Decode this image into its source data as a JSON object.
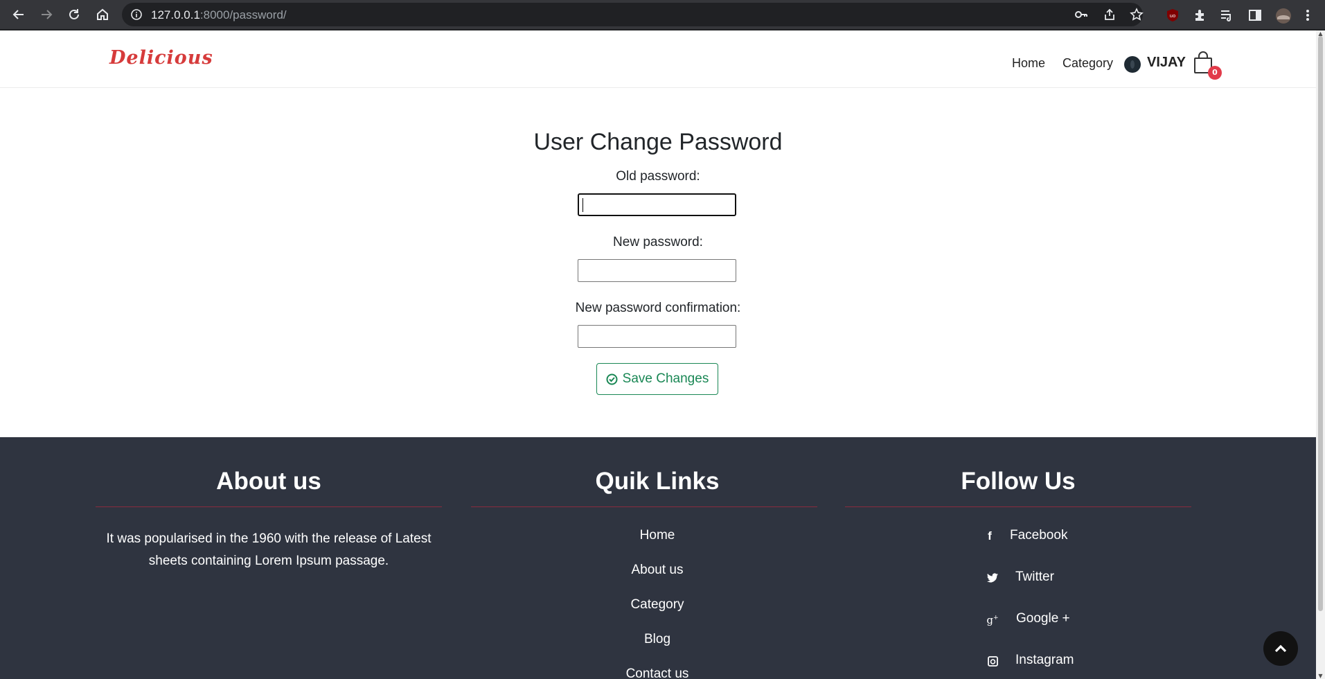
{
  "browser": {
    "url_host": "127.0.0.1",
    "url_rest": ":8000/password/"
  },
  "site": {
    "logo": "Delicious",
    "nav": {
      "home": "Home",
      "category": "Category"
    },
    "user_name": "VIJAY",
    "cart_count": "0"
  },
  "form": {
    "title": "User Change Password",
    "old_password_label": "Old password:",
    "new_password_label": "New password:",
    "confirm_label": "New password confirmation:",
    "save_label": "Save Changes"
  },
  "footer": {
    "about": {
      "heading": "About us",
      "text": "It was popularised in the 1960 with the release of Latest sheets containing Lorem Ipsum passage."
    },
    "links": {
      "heading": "Quik Links",
      "items": [
        "Home",
        "About us",
        "Category",
        "Blog",
        "Contact us"
      ]
    },
    "follow": {
      "heading": "Follow Us",
      "items": [
        {
          "label": "Facebook",
          "icon": "facebook-icon"
        },
        {
          "label": "Twitter",
          "icon": "twitter-icon"
        },
        {
          "label": "Google +",
          "icon": "google-plus-icon"
        },
        {
          "label": "Instagram",
          "icon": "instagram-icon"
        }
      ]
    }
  },
  "colors": {
    "accent_green": "#198754",
    "logo_red": "#d63b3b",
    "footer_bg": "#2f3440",
    "badge_red": "#e23b4a"
  }
}
